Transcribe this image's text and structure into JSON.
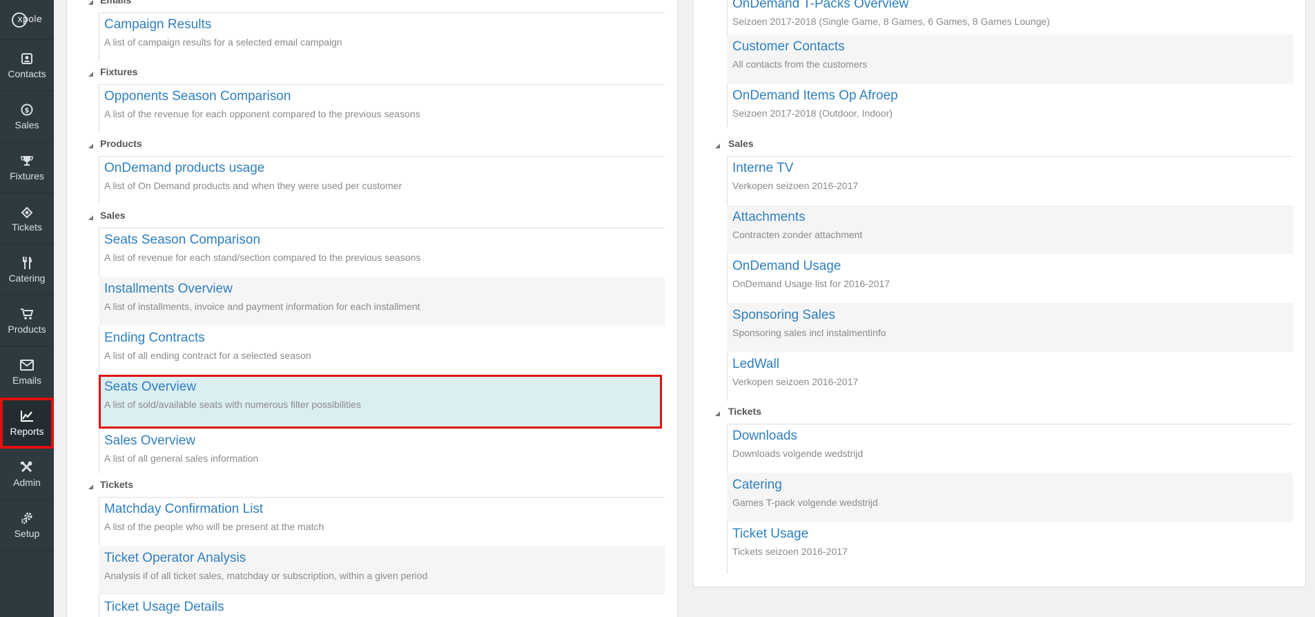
{
  "sidebar": {
    "logo_text": "xpole",
    "items": [
      {
        "label": "Contacts",
        "icon": "contacts-icon"
      },
      {
        "label": "Sales",
        "icon": "dollar-icon"
      },
      {
        "label": "Fixtures",
        "icon": "trophy-icon"
      },
      {
        "label": "Tickets",
        "icon": "ticket-icon"
      },
      {
        "label": "Catering",
        "icon": "cutlery-icon"
      },
      {
        "label": "Products",
        "icon": "cart-icon"
      },
      {
        "label": "Emails",
        "icon": "envelope-icon"
      },
      {
        "label": "Reports",
        "icon": "chart-icon",
        "active": true
      },
      {
        "label": "Admin",
        "icon": "tools-icon"
      },
      {
        "label": "Setup",
        "icon": "gears-icon"
      }
    ]
  },
  "left": {
    "sections": [
      {
        "name": "Emails"
      },
      {
        "name": "Fixtures"
      },
      {
        "name": "Products"
      },
      {
        "name": "Sales"
      },
      {
        "name": "Tickets"
      }
    ],
    "reports": [
      {
        "title": "Campaign Results",
        "desc": "A list of campaign results for a selected email campaign"
      },
      {
        "title": "Opponents Season Comparison",
        "desc": "A list of the revenue for each opponent compared to the previous seasons"
      },
      {
        "title": "OnDemand products usage",
        "desc": "A list of On Demand products and when they were used per customer"
      },
      {
        "title": "Seats Season Comparison",
        "desc": "A list of revenue for each stand/section compared to the previous seasons"
      },
      {
        "title": "Installments Overview",
        "desc": "A list of installments, invoice and payment information for each installment"
      },
      {
        "title": "Ending Contracts",
        "desc": "A list of all ending contract for a selected season"
      },
      {
        "title": "Seats Overview",
        "desc": "A list of sold/available seats with numerous filter possibilities"
      },
      {
        "title": "Sales Overview",
        "desc": "A list of all general sales information"
      },
      {
        "title": "Matchday Confirmation List",
        "desc": "A list of the people who will be present at the match"
      },
      {
        "title": "Ticket Operator Analysis",
        "desc": "Analysis if of all ticket sales, matchday or subscription, within a given period"
      },
      {
        "title": "Ticket Usage Details",
        "desc": ""
      }
    ]
  },
  "right": {
    "sections": [
      {
        "name": "Sales"
      },
      {
        "name": "Tickets"
      }
    ],
    "reports": [
      {
        "title": "OnDemand T-Packs Overview",
        "desc": "Seizoen 2017-2018 (Single Game, 8 Games, 6 Games, 8 Games Lounge)"
      },
      {
        "title": "Customer Contacts",
        "desc": "All contacts from the customers"
      },
      {
        "title": "OnDemand Items Op Afroep",
        "desc": "Seizoen 2017-2018 (Outdoor, Indoor)"
      },
      {
        "title": "Interne TV",
        "desc": "Verkopen seizoen 2016-2017"
      },
      {
        "title": "Attachments",
        "desc": "Contracten zonder attachment"
      },
      {
        "title": "OnDemand Usage",
        "desc": "OnDemand Usage list for 2016-2017"
      },
      {
        "title": "Sponsoring Sales",
        "desc": "Sponsoring sales incl instalmentinfo"
      },
      {
        "title": "LedWall",
        "desc": "Verkopen seizoen 2016-2017"
      },
      {
        "title": "Downloads",
        "desc": "Downloads volgende wedstrijd"
      },
      {
        "title": "Catering",
        "desc": "Games T-pack volgende wedstrijd"
      },
      {
        "title": "Ticket Usage",
        "desc": "Tickets seizoen 2016-2017"
      }
    ]
  }
}
